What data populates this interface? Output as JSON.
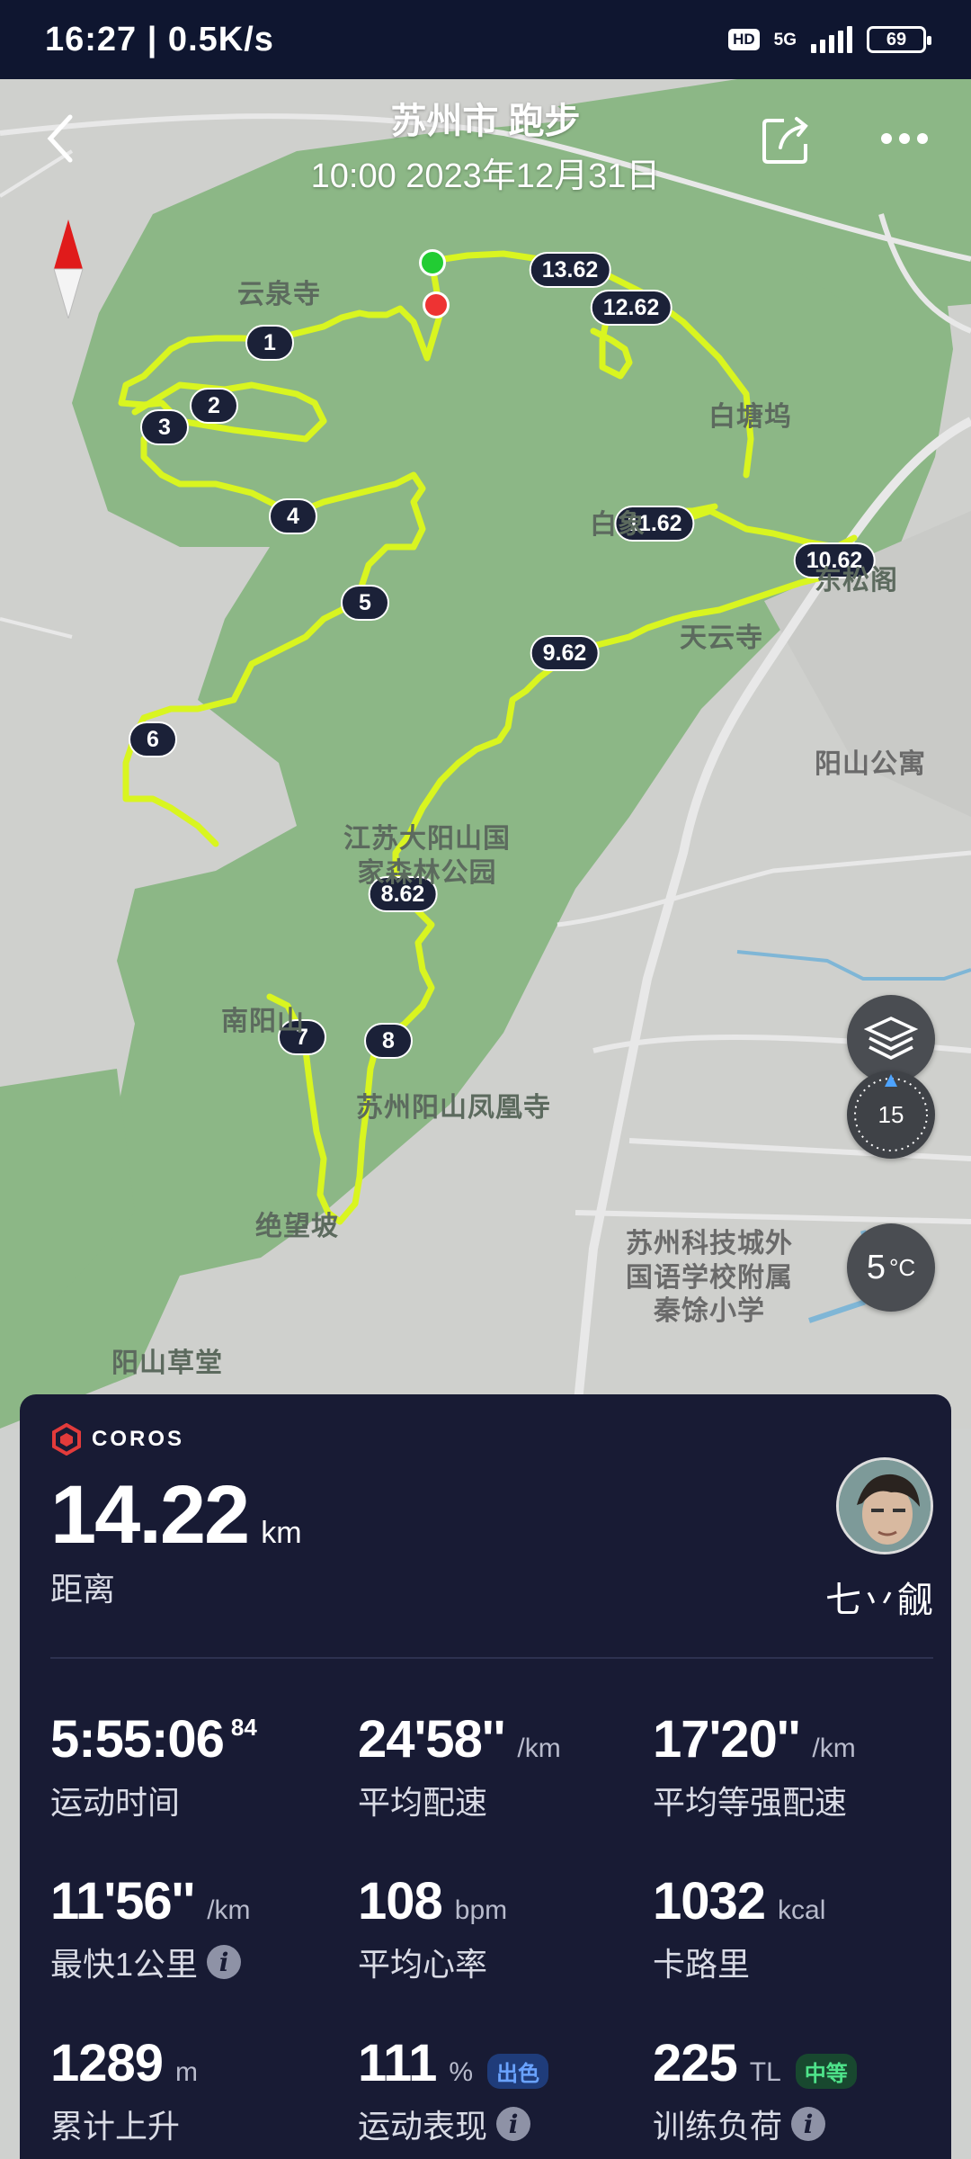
{
  "status_bar": {
    "time_speed": "16:27 | 0.5K/s",
    "hd": "HD",
    "network": "5G",
    "battery": "69"
  },
  "header": {
    "title": "苏州市 跑步",
    "subtitle": "10:00 2023年12月31日"
  },
  "map": {
    "labels": [
      "云泉寺",
      "白塘坞",
      "白象",
      "东松阁",
      "天云寺",
      "阳山公寓",
      "江苏大阳山国",
      "家森林公园",
      "南阳山",
      "苏州阳山凤凰寺",
      "绝望坡",
      "苏州科技城外",
      "国语学校附属",
      "秦馀小学",
      "阳山草堂"
    ],
    "route_markers": [
      "1",
      "2",
      "3",
      "4",
      "5",
      "6",
      "7",
      "8",
      "8.62",
      "9.62",
      "10.62",
      "11.62",
      "12.62",
      "13.62"
    ],
    "wind_speed": "15",
    "temperature": "5",
    "temperature_unit": "°C",
    "start_color": "#22cc33",
    "end_color": "#ee3333",
    "route_color": "#d9f520"
  },
  "card": {
    "brand": "COROS",
    "distance_value": "14.22",
    "distance_unit": "km",
    "distance_label": "距离",
    "username": "七丷觎",
    "stats": {
      "duration": {
        "value": "5:55:06",
        "sup": "84",
        "label": "运动时间"
      },
      "avg_pace": {
        "value": "24'58''",
        "unit": "/km",
        "label": "平均配速"
      },
      "avg_grade_pace": {
        "value": "17'20''",
        "unit": "/km",
        "label": "平均等强配速"
      },
      "fastest_km": {
        "value": "11'56''",
        "unit": "/km",
        "label": "最快1公里"
      },
      "avg_hr": {
        "value": "108",
        "unit": "bpm",
        "label": "平均心率"
      },
      "calories": {
        "value": "1032",
        "unit": "kcal",
        "label": "卡路里"
      },
      "ascent": {
        "value": "1289",
        "unit": "m",
        "label": "累计上升"
      },
      "performance": {
        "value": "111",
        "unit": "%",
        "badge": "出色",
        "label": "运动表现"
      },
      "training_load": {
        "value": "225",
        "unit": "TL",
        "badge": "中等",
        "label": "训练负荷"
      }
    }
  }
}
